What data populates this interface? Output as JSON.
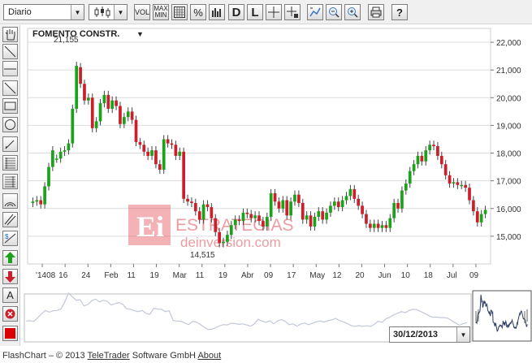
{
  "toolbar": {
    "period_select": "Diario",
    "vol_label": "VOL",
    "maxmin_label_top": "MAX",
    "maxmin_label_bottom": "MIN",
    "percent_label": "%",
    "d_label": "D",
    "l_label": "L",
    "help_label": "?"
  },
  "chart": {
    "title": "FOMENTO CONSTR.",
    "max_label": "21,155",
    "min_label": "14,515",
    "watermark_main": "ESTRATEGIAS",
    "watermark_sub": "deinversion.com"
  },
  "navigator": {
    "date": "30/12/2013"
  },
  "footer": {
    "prefix": "FlashChart – © 2013 ",
    "company": "TeleTrader",
    "middle": " Software GmbH ",
    "about": "About"
  },
  "colors": {
    "up": "#1aa31a",
    "down": "#cc1f2a",
    "grid": "#dcdcdc",
    "watermark": "#d9232e"
  },
  "chart_data": {
    "type": "candlestick",
    "title": "FOMENTO CONSTR.",
    "ylim": [
      14000,
      22500
    ],
    "y_ticks": [
      "15,000",
      "16,000",
      "17,000",
      "18,000",
      "19,000",
      "20,000",
      "21,000",
      "22,000"
    ],
    "y_tick_values": [
      15000,
      16000,
      17000,
      18000,
      19000,
      20000,
      21000,
      22000
    ],
    "x_ticks": [
      "'1408",
      "16",
      "24",
      "Feb",
      "11",
      "19",
      "Mar",
      "11",
      "19",
      "Abr",
      "09",
      "17",
      "May",
      "12",
      "20",
      "Jun",
      "10",
      "18",
      "Jul",
      "09"
    ],
    "annotations": [
      {
        "label": "21,155",
        "value": 21155
      },
      {
        "label": "14,515",
        "value": 14515
      }
    ],
    "closes": [
      16250,
      16300,
      16150,
      16800,
      17500,
      18100,
      17800,
      18050,
      18100,
      18350,
      19600,
      21150,
      20500,
      19900,
      20000,
      18900,
      19150,
      19800,
      20100,
      19600,
      19900,
      19700,
      19050,
      19300,
      19500,
      19200,
      18400,
      18300,
      18050,
      17900,
      18100,
      17600,
      17400,
      18500,
      18350,
      18300,
      17900,
      18050,
      16350,
      16250,
      16200,
      15900,
      15600,
      16150,
      16050,
      15650,
      15150,
      14750,
      14800,
      15050,
      15400,
      15600,
      15550,
      15850,
      15800,
      15650,
      15750,
      15550,
      15350,
      15700,
      16550,
      16250,
      16000,
      16300,
      15750,
      16250,
      16500,
      16200,
      15600,
      15750,
      15350,
      15700,
      15900,
      15600,
      15850,
      16100,
      16250,
      16050,
      16300,
      16450,
      16700,
      16350,
      16100,
      15800,
      15450,
      15300,
      15450,
      15300,
      15400,
      15300,
      15650,
      16200,
      16000,
      16650,
      16900,
      17350,
      17600,
      17900,
      17700,
      18100,
      18300,
      18250,
      17900,
      17600,
      17200,
      16900,
      16950,
      16850,
      16850,
      16750,
      16300,
      15900,
      15500,
      15800,
      15950
    ],
    "opens": [
      16200,
      16250,
      16300,
      16150,
      16800,
      17500,
      17800,
      17800,
      18050,
      18100,
      18350,
      19600,
      21100,
      20500,
      19900,
      20000,
      18900,
      19150,
      19800,
      20100,
      19600,
      19900,
      19700,
      19050,
      19300,
      19500,
      19200,
      18400,
      18300,
      18050,
      17900,
      18100,
      17600,
      17400,
      18500,
      18350,
      18300,
      17900,
      18050,
      16350,
      16250,
      16200,
      15900,
      15600,
      16150,
      16050,
      15650,
      15150,
      14750,
      14800,
      15050,
      15400,
      15600,
      15550,
      15850,
      15800,
      15650,
      15750,
      15550,
      15350,
      15700,
      16550,
      16250,
      16000,
      16300,
      15750,
      16250,
      16500,
      16200,
      15600,
      15750,
      15350,
      15700,
      15900,
      15600,
      15850,
      16100,
      16250,
      16050,
      16300,
      16450,
      16700,
      16350,
      16100,
      15800,
      15450,
      15300,
      15450,
      15300,
      15400,
      15300,
      15650,
      16200,
      16000,
      16650,
      16900,
      17350,
      17600,
      17900,
      17700,
      18100,
      18300,
      18250,
      17900,
      17600,
      17200,
      16900,
      16950,
      16850,
      16850,
      16750,
      16300,
      15900,
      15500,
      15800
    ]
  }
}
